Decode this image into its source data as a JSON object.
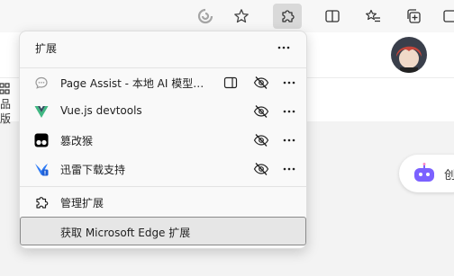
{
  "browser_toolbar": {
    "buttons": [
      {
        "name": "read-aloud-icon"
      },
      {
        "name": "favorite-star-icon"
      },
      {
        "name": "extensions-puzzle-icon"
      },
      {
        "name": "split-screen-icon"
      },
      {
        "name": "favorites-list-icon"
      },
      {
        "name": "collections-icon"
      },
      {
        "name": "profile-sidebar-icon"
      }
    ]
  },
  "extensions_panel": {
    "title": "扩展",
    "items": [
      {
        "name": "Page Assist - 本地 AI 模型的...",
        "icon": "page-assist-icon",
        "has_sidebar": true,
        "visibility": "hidden"
      },
      {
        "name": "Vue.js devtools",
        "icon": "vue-logo-icon",
        "has_sidebar": false,
        "visibility": "hidden"
      },
      {
        "name": "篡改猴",
        "icon": "tampermonkey-icon",
        "has_sidebar": false,
        "visibility": "hidden"
      },
      {
        "name": "迅雷下载支持",
        "icon": "thunder-icon",
        "has_sidebar": false,
        "visibility": "hidden"
      }
    ],
    "manage_label": "管理扩展",
    "get_label": "获取 Microsoft Edge 扩展"
  },
  "page_peek": {
    "left_text": "品\n版",
    "right_text": "创"
  },
  "colors": {
    "vue_green": "#41b883",
    "vue_dark": "#34495e",
    "thunder_blue": "#2f7cf6",
    "copilot_purple": "#7b61ff"
  }
}
